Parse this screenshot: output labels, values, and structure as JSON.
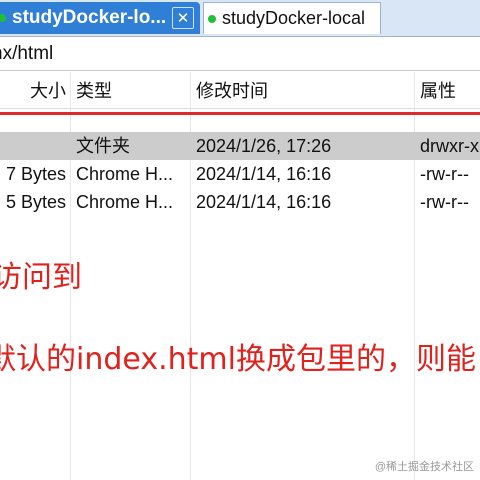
{
  "tabs": [
    {
      "label": "studyDocker-lo...",
      "active": true,
      "close": "✕"
    },
    {
      "label": "studyDocker-local",
      "active": false
    }
  ],
  "path": {
    "value": "nx/html"
  },
  "columns": {
    "size": "大小",
    "type": "类型",
    "modified": "修改时间",
    "attrs": "属性"
  },
  "files": [
    {
      "size": "",
      "type": "文件夹",
      "modified": "2024/1/26, 17:26",
      "attrs": "drwxr-x",
      "selected": true
    },
    {
      "size": "7 Bytes",
      "type": "Chrome H...",
      "modified": "2024/1/14, 16:16",
      "attrs": "-rw-r--",
      "selected": false
    },
    {
      "size": "5 Bytes",
      "type": "Chrome H...",
      "modified": "2024/1/14, 16:16",
      "attrs": "-rw-r--",
      "selected": false
    }
  ],
  "annotations": {
    "line1": "访问到",
    "line2": "默认的index.html换成包里的，则能"
  },
  "watermark": "@稀土掘金技术社区",
  "colors": {
    "accent": "#2f7fd6",
    "annotation": "#e0211c",
    "online_dot": "#1fbf3a",
    "selected_row": "#cccccc"
  }
}
